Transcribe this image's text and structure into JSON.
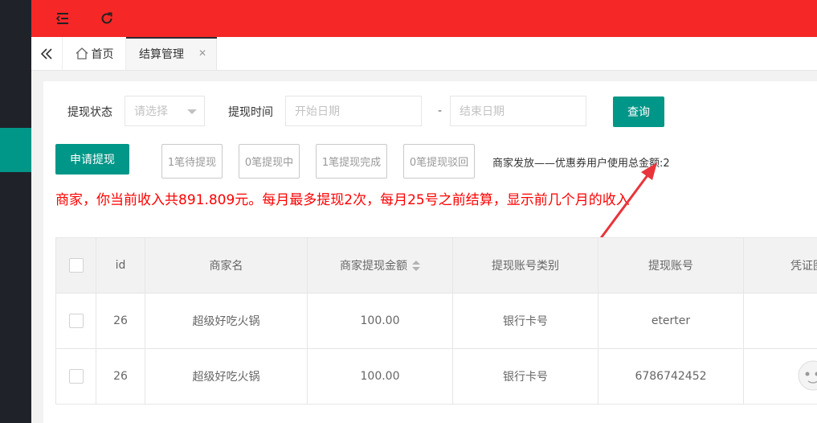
{
  "topbar": {
    "icons": [
      "menu-fold-icon",
      "refresh-icon"
    ],
    "accent": "#f52727"
  },
  "sidebar": {
    "active_color": "#009688"
  },
  "tabs": [
    {
      "label": "首页",
      "icon": "home-icon"
    },
    {
      "label": "结算管理",
      "closable": true
    }
  ],
  "filters": {
    "status_label": "提现状态",
    "status_placeholder": "请选择",
    "time_label": "提现时间",
    "start_placeholder": "开始日期",
    "separator": "-",
    "end_placeholder": "结束日期",
    "query_button": "查询"
  },
  "actions": {
    "apply_button": "申请提现",
    "status_counts": [
      "1笔待提现",
      "0笔提现中",
      "1笔提现完成",
      "0笔提现驳回"
    ],
    "coupon_text": "商家发放——优惠券用户使用总金额:2"
  },
  "income_notice": "商家，你当前收入共891.809元。每月最多提现2次，每月25号之前结算，显示前几个月的收入",
  "table": {
    "headers": [
      "id",
      "商家名",
      "商家提现金额",
      "提现账号类别",
      "提现账号",
      "凭证图"
    ],
    "sortable_column": "商家提现金额",
    "rows": [
      [
        "26",
        "超级好吃火锅",
        "100.00",
        "银行卡号",
        "eterter",
        ""
      ],
      [
        "26",
        "超级好吃火锅",
        "100.00",
        "银行卡号",
        "6786742452",
        ""
      ]
    ]
  },
  "colors": {
    "primary": "#009688",
    "notice": "#ff0000",
    "annotation_arrow": "#e8343a"
  }
}
